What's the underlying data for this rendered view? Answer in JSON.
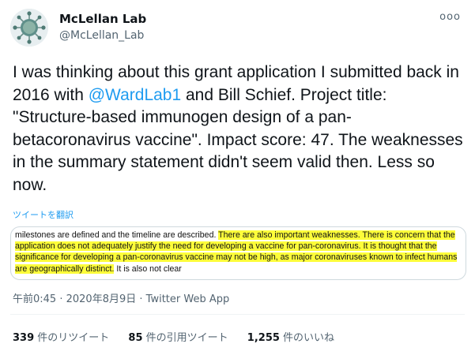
{
  "profile": {
    "name": "McLellan Lab",
    "handle": "@McLellan_Lab",
    "avatar_icon": "coronavirus-logo-icon",
    "more_label": "ooo"
  },
  "tweet": {
    "text_before": "I was thinking about this grant application I submitted back in 2016 with ",
    "mention": "@WardLab1",
    "text_after": " and Bill Schief. Project title: \"Structure-based immunogen design of a pan-betacoronavirus vaccine\". Impact score: 47. The weaknesses in the summary statement didn't seem valid then. Less so now.",
    "translate_label": "ツイートを翻訳"
  },
  "media": {
    "plain_start": "milestones are defined and the timeline are described.  ",
    "highlighted": "There are also important weaknesses.  There is concern that the application does not adequately justify the need for developing a vaccine for pan-coronavirus.  It is thought that the significance for developing a pan-coronavirus vaccine may not be high, as major coronaviruses known to infect humans are geographically distinct.",
    "plain_end": " It is also not clear"
  },
  "meta": {
    "time": "午前0:45",
    "sep1": " · ",
    "date": "2020年8月9日",
    "sep2": " · ",
    "app": "Twitter Web App"
  },
  "stats": {
    "retweets_count": "339",
    "retweets_label": " 件のリツイート",
    "quotes_count": "85",
    "quotes_label": " 件の引用ツイート",
    "likes_count": "1,255",
    "likes_label": " 件のいいね"
  },
  "colors": {
    "accent": "#1d9bf0",
    "highlight": "#fdfd3a"
  }
}
